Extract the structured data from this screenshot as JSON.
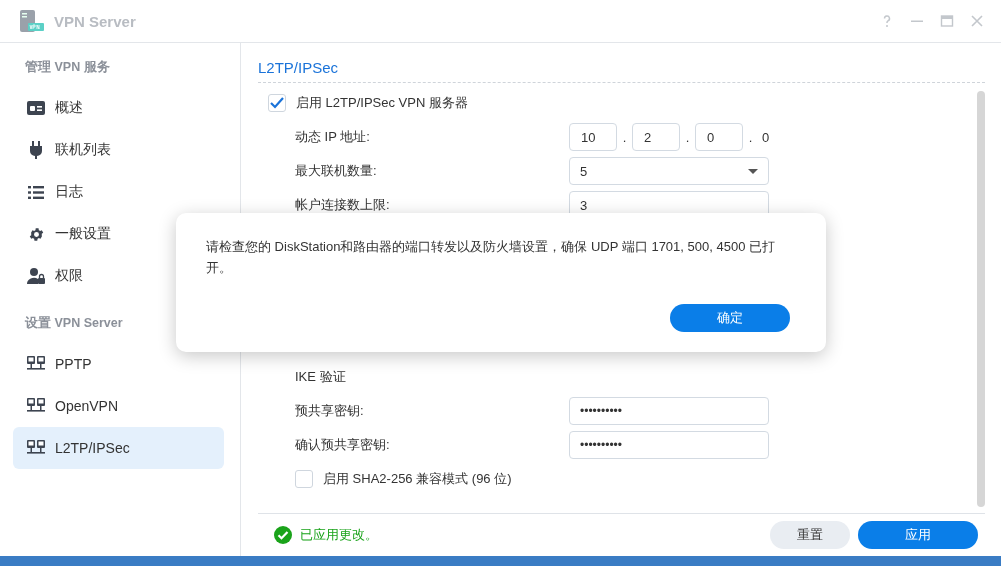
{
  "window": {
    "title": "VPN Server"
  },
  "sidebar": {
    "sections": [
      {
        "heading": "管理 VPN 服务",
        "items": [
          {
            "label": "概述",
            "kind": "overview",
            "selected": false
          },
          {
            "label": "联机列表",
            "kind": "plug",
            "selected": false
          },
          {
            "label": "日志",
            "kind": "list",
            "selected": false
          },
          {
            "label": "一般设置",
            "kind": "gear",
            "selected": false
          },
          {
            "label": "权限",
            "kind": "user",
            "selected": false
          }
        ]
      },
      {
        "heading": "设置 VPN Server",
        "items": [
          {
            "label": "PPTP",
            "kind": "server",
            "selected": false
          },
          {
            "label": "OpenVPN",
            "kind": "server",
            "selected": false
          },
          {
            "label": "L2TP/IPSec",
            "kind": "server",
            "selected": true
          }
        ]
      }
    ]
  },
  "content": {
    "title": "L2TP/IPSec",
    "rows": [
      {
        "kind": "checkbox",
        "label": "启用 L2TP/IPSec VPN 服务器",
        "checked": true
      },
      {
        "kind": "ip",
        "label": "动态 IP 地址:",
        "octets": [
          {
            "value": "10",
            "editable": true
          },
          {
            "separator": ".",
            "value": "2",
            "editable": true
          },
          {
            "separator": ".",
            "value": "0",
            "editable": true
          },
          {
            "separator": ".",
            "value": "0",
            "editable": false
          }
        ]
      },
      {
        "kind": "select",
        "label": "最大联机数量:",
        "value": "5"
      },
      {
        "kind": "input",
        "label": "帐户连接数上限:",
        "value": "3"
      },
      {
        "kind": "gap"
      },
      {
        "kind": "heading",
        "label": "IKE 验证"
      },
      {
        "kind": "password",
        "label": "预共享密钥:",
        "value": "••••••••••"
      },
      {
        "kind": "password",
        "label": "确认预共享密钥:",
        "value": "••••••••••"
      },
      {
        "kind": "checkbox",
        "label": "启用 SHA2-256 兼容模式 (96 位)",
        "checked": false
      }
    ]
  },
  "footer": {
    "status": {
      "kind": "success",
      "text": "已应用更改。"
    },
    "buttons": [
      {
        "label": "重置",
        "kind": "secondary"
      },
      {
        "label": "应用",
        "kind": "primary"
      }
    ]
  },
  "dialog": {
    "message": "请检查您的 DiskStation和路由器的端口转发以及防火墙设置，确保 UDP 端口 1701, 500, 4500 已打开。",
    "button": "确定"
  }
}
